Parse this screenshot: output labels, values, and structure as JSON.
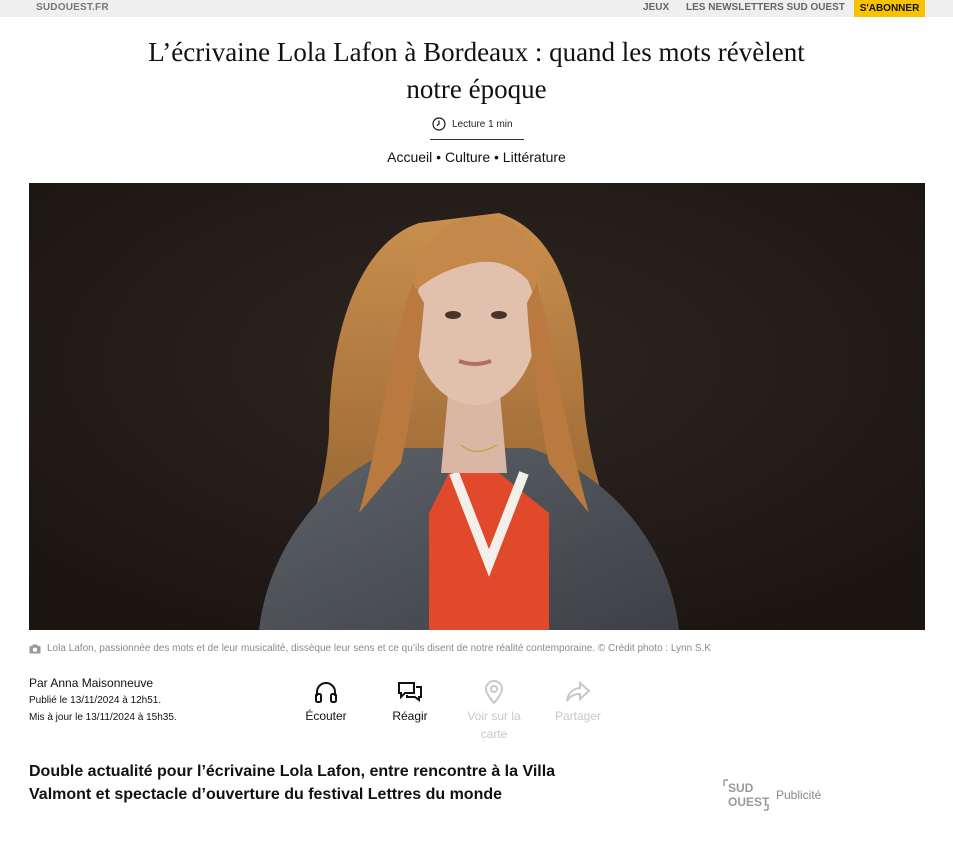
{
  "topbar": {
    "brand": "SUDOUEST.FR",
    "nav": [
      "JEUX",
      "LES NEWSLETTERS SUD OUEST"
    ],
    "subscribe": "S'ABONNER"
  },
  "article": {
    "title": "L’écrivaine Lola Lafon à Bordeaux : quand les mots révèlent notre époque",
    "reading_time": "Lecture 1 min",
    "breadcrumb": [
      "Accueil",
      "Culture",
      "Littérature"
    ],
    "breadcrumb_separator": "•",
    "caption": "Lola Lafon, passionnée des mots et de leur musicalité, dissèque leur sens et ce qu’ils disent de notre réalité contemporaine. © Crédit photo : Lynn S.K",
    "author": "Par Anna Maisonneuve",
    "published": "Publié le 13/11/2024 à 12h51.",
    "updated": "Mis à jour le 13/11/2024 à 15h35.",
    "lead": "Double actualité pour l’écrivaine Lola Lafon, entre rencontre à la Villa Valmont et spectacle d’ouverture du festival Lettres du monde"
  },
  "actions": [
    {
      "label": "Écouter",
      "icon": "headphones-icon",
      "enabled": true
    },
    {
      "label": "Réagir",
      "icon": "comments-icon",
      "enabled": true
    },
    {
      "label": "Voir sur la carte",
      "icon": "map-pin-icon",
      "enabled": false
    },
    {
      "label": "Partager",
      "icon": "share-icon",
      "enabled": false
    }
  ],
  "ad": {
    "logo_text": "SUD OUEST",
    "label": "Publicité"
  },
  "colors": {
    "subscribe_bg": "#f7c300",
    "topbar_bg": "#efefef",
    "disabled": "#c8c8c8"
  }
}
